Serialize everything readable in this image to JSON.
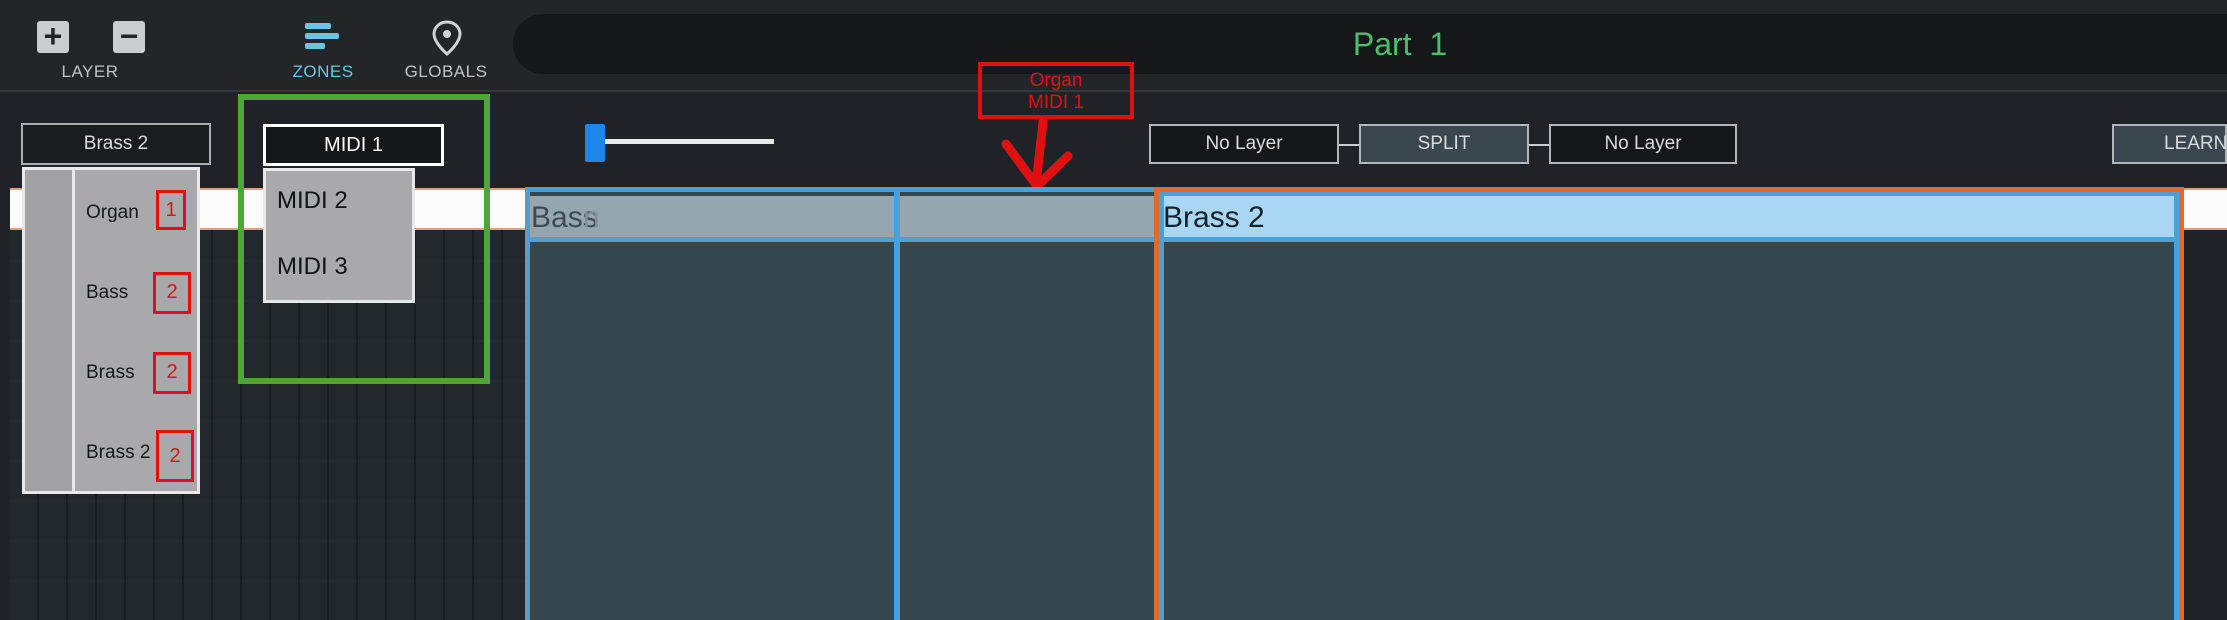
{
  "toolbar": {
    "add_glyph": "+",
    "remove_glyph": "−",
    "layer_label": "LAYER",
    "zones_label": "ZONES",
    "globals_label": "GLOBALS",
    "icons": [
      "plus-icon",
      "minus-icon",
      "zones-icon",
      "location-pin-icon"
    ],
    "active_color": "#6cc4e0"
  },
  "part": {
    "title": "Part  1",
    "title_color": "#4fbd6b"
  },
  "layer_select": {
    "value": "Brass 2",
    "options": [
      {
        "label": "Organ",
        "badge": "1"
      },
      {
        "label": "Bass",
        "badge": "2"
      },
      {
        "label": "Brass",
        "badge": "2"
      },
      {
        "label": "Brass 2",
        "badge": "2"
      }
    ]
  },
  "midi_select": {
    "value": "MIDI 1",
    "options": [
      "MIDI 2",
      "MIDI 3"
    ]
  },
  "annotation": {
    "line1": "Organ",
    "line2": "MIDI 1",
    "color": "#e01010"
  },
  "split_controls": {
    "left": "No Layer",
    "center": "SPLIT",
    "right": "No Layer",
    "learn": "LEARN"
  },
  "zones": {
    "bass": "Bass",
    "bass_ghost": "n",
    "brass2": "Brass 2",
    "zone_color": "#47a2dc",
    "selected_color": "#e06a30"
  }
}
